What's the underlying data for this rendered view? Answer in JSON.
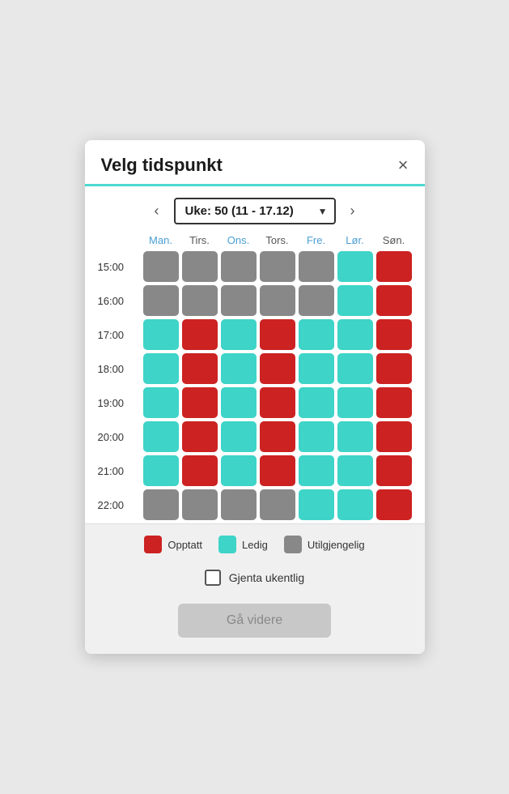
{
  "modal": {
    "title": "Velg tidspunkt",
    "close_label": "×"
  },
  "week_nav": {
    "prev_label": "‹",
    "next_label": "›",
    "week_label": "Uke: 50 (11 - 17.12)",
    "dropdown_options": [
      "Uke: 50 (11 - 17.12)"
    ]
  },
  "days": [
    {
      "label": "Man.",
      "link": true
    },
    {
      "label": "Tirs.",
      "link": false
    },
    {
      "label": "Ons.",
      "link": true
    },
    {
      "label": "Tors.",
      "link": false
    },
    {
      "label": "Fre.",
      "link": true
    },
    {
      "label": "Lør.",
      "link": true
    },
    {
      "label": "Søn.",
      "link": false
    }
  ],
  "time_slots": [
    {
      "time": "15:00",
      "slots": [
        "unavailable",
        "unavailable",
        "unavailable",
        "unavailable",
        "unavailable",
        "available",
        "occupied"
      ]
    },
    {
      "time": "16:00",
      "slots": [
        "unavailable",
        "unavailable",
        "unavailable",
        "unavailable",
        "unavailable",
        "available",
        "occupied"
      ]
    },
    {
      "time": "17:00",
      "slots": [
        "available",
        "occupied",
        "available",
        "occupied",
        "available",
        "available",
        "occupied"
      ]
    },
    {
      "time": "18:00",
      "slots": [
        "available",
        "occupied",
        "available",
        "occupied",
        "available",
        "available",
        "occupied"
      ]
    },
    {
      "time": "19:00",
      "slots": [
        "available",
        "occupied",
        "available",
        "occupied",
        "available",
        "available",
        "occupied"
      ]
    },
    {
      "time": "20:00",
      "slots": [
        "available",
        "occupied",
        "available",
        "occupied",
        "available",
        "available",
        "occupied"
      ]
    },
    {
      "time": "21:00",
      "slots": [
        "available",
        "occupied",
        "available",
        "occupied",
        "available",
        "available",
        "occupied"
      ]
    },
    {
      "time": "22:00",
      "slots": [
        "unavailable",
        "unavailable",
        "unavailable",
        "unavailable",
        "available",
        "available",
        "occupied"
      ]
    }
  ],
  "legend": {
    "occupied_label": "Opptatt",
    "available_label": "Ledig",
    "unavailable_label": "Utilgjengelig",
    "colors": {
      "occupied": "#cc2222",
      "available": "#3ed4c8",
      "unavailable": "#888888"
    }
  },
  "repeat": {
    "label": "Gjenta ukentlig"
  },
  "footer": {
    "continue_label": "Gå videre"
  }
}
